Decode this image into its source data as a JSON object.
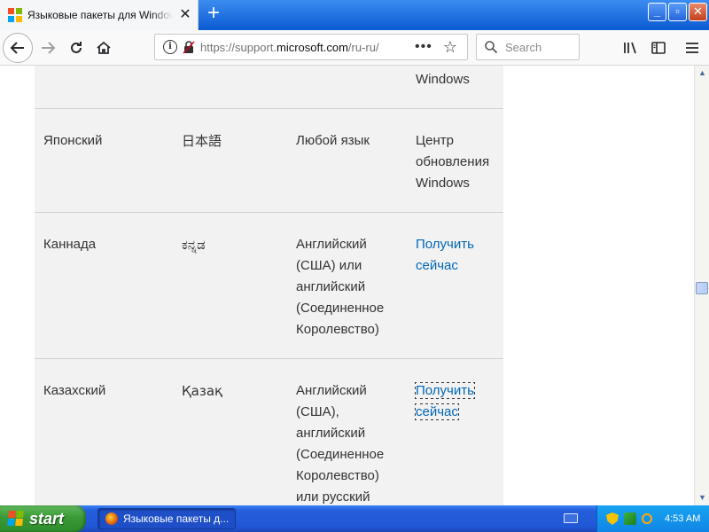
{
  "browser": {
    "tab": {
      "title": "Языковые пакеты для Windows",
      "close_icon": "✕"
    },
    "new_tab_icon": "+",
    "window_controls": {
      "minimize": "_",
      "maximize": "▫",
      "close": "✕"
    },
    "url": {
      "prefix": "https://support.",
      "domain": "microsoft.com",
      "suffix": "/ru-ru/"
    },
    "page_actions": "•••",
    "search": {
      "placeholder": "Search"
    }
  },
  "table": {
    "rows": [
      {
        "language": "",
        "native": "",
        "base": "",
        "action": "Windows",
        "action_is_link": false
      },
      {
        "language": "Японский",
        "native": "日本語",
        "base": "Любой язык",
        "action": "Центр обновления Windows",
        "action_is_link": false
      },
      {
        "language": "Каннада",
        "native": "ಕನ್ನಡ",
        "base": "Английский (США) или английский (Соединенное Королевство)",
        "action": "Получить сейчас",
        "action_is_link": true
      },
      {
        "language": "Казахский",
        "native": "Қазақ",
        "base": "Английский (США), английский (Соединенное Королевство) или русский",
        "action": "Получить сейчас",
        "action_is_link": true
      }
    ]
  },
  "taskbar": {
    "start_label": "start",
    "task_label": "Языковые пакеты д...",
    "clock": "4:53 AM"
  },
  "colors": {
    "link": "#0067b8",
    "table_bg": "#f2f2f2",
    "tabstrip": "#0b5bd2",
    "taskbar": "#245edb"
  }
}
